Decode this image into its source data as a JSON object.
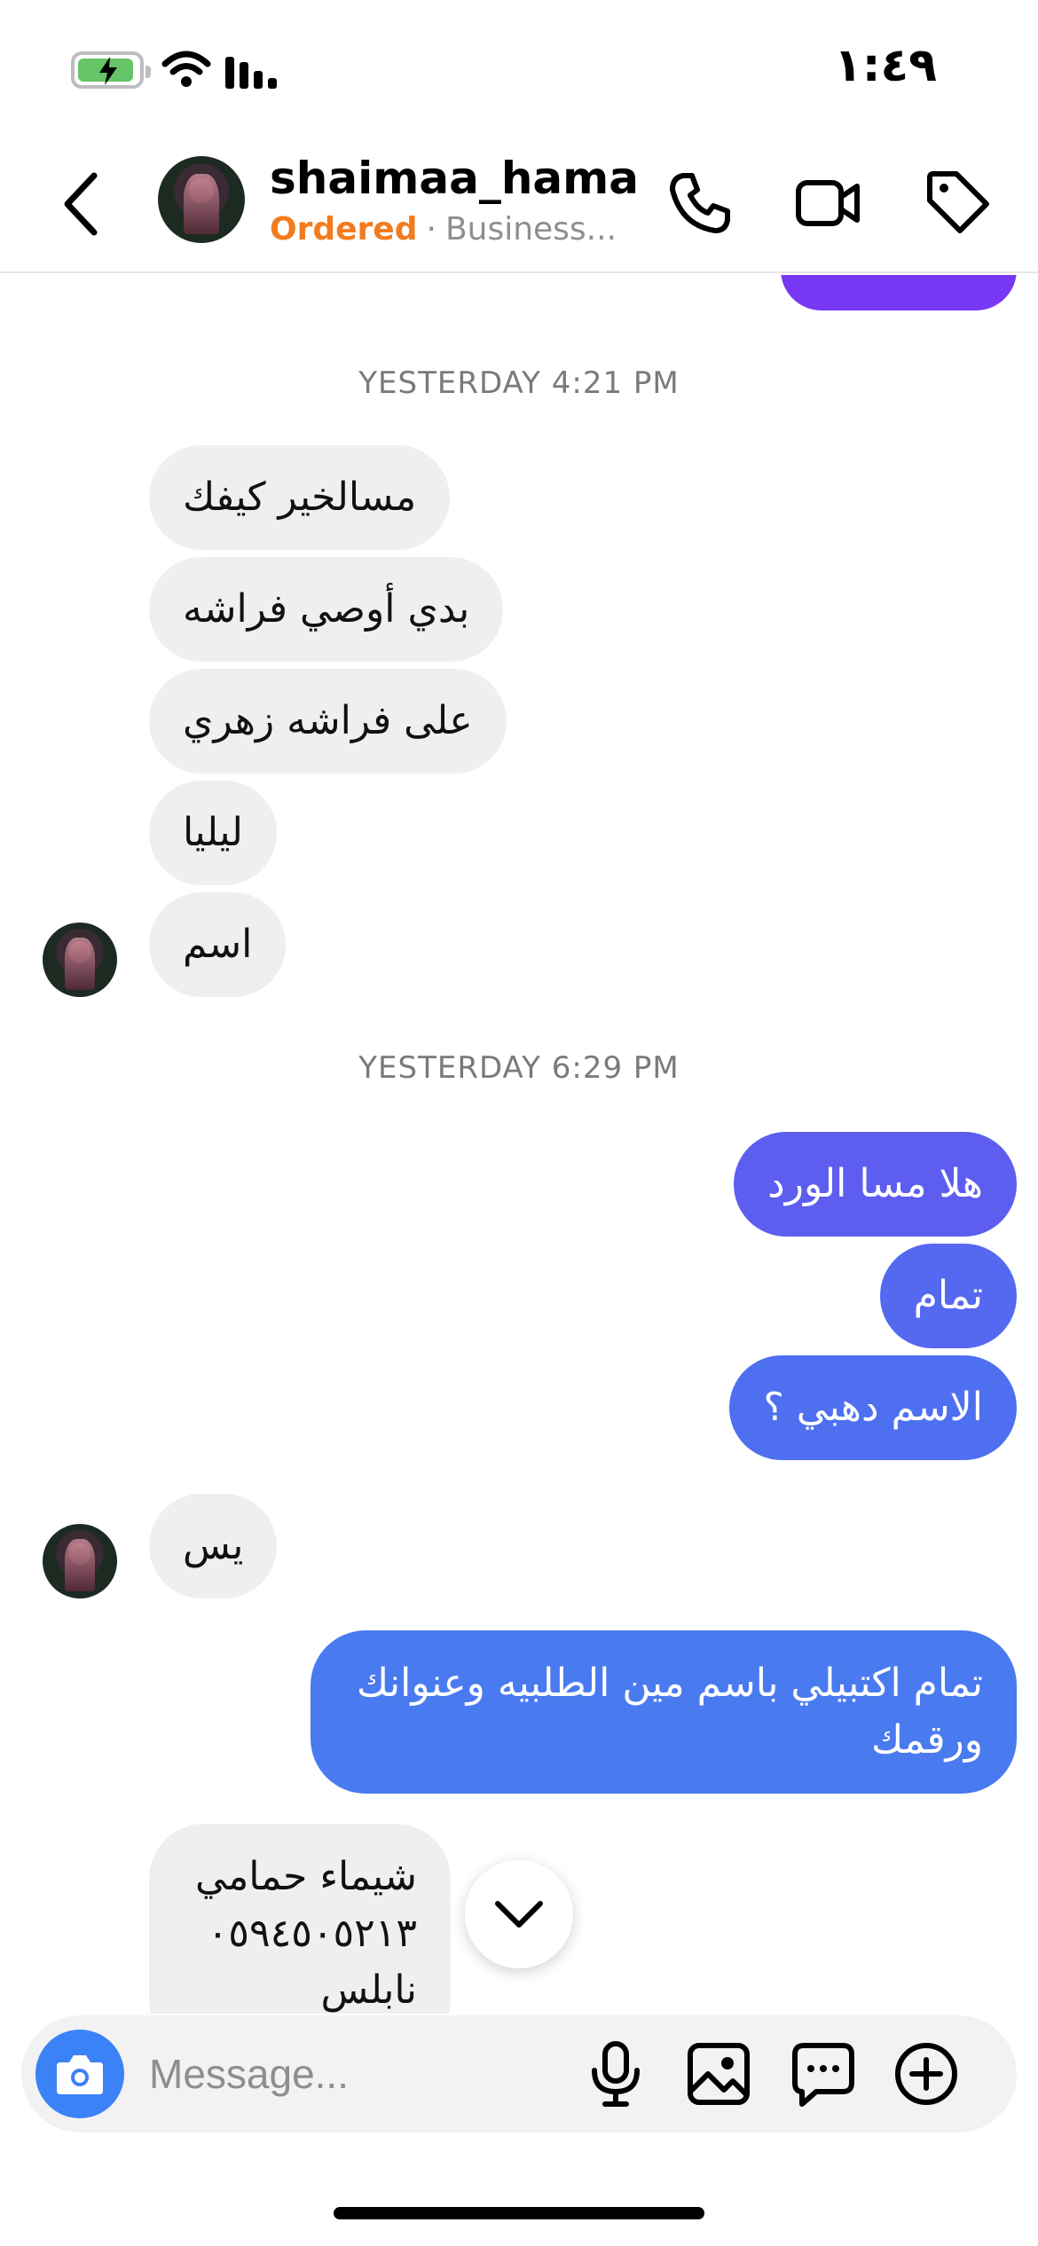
{
  "status_bar": {
    "time": "١:٤٩",
    "battery_color": "#65c466"
  },
  "header": {
    "contact_name": "shaimaa_hama...",
    "order_status": "Ordered",
    "separator": "·",
    "account_type": "Business...",
    "icons": [
      "back-chevron",
      "phone-icon",
      "video-camera-icon",
      "tag-icon"
    ]
  },
  "conversation": {
    "timestamps": [
      "YESTERDAY 4:21 PM",
      "YESTERDAY 6:29 PM"
    ],
    "messages": [
      {
        "sender": "contact",
        "text": "مسالخير كيفك"
      },
      {
        "sender": "contact",
        "text": "بدي أوصي فراشه"
      },
      {
        "sender": "contact",
        "text": "على فراشه زهري"
      },
      {
        "sender": "contact",
        "text": "ليليا"
      },
      {
        "sender": "contact",
        "text": "اسم"
      },
      {
        "sender": "me",
        "text": "هلا مسا الورد"
      },
      {
        "sender": "me",
        "text": "تمام"
      },
      {
        "sender": "me",
        "text": "الاسم دهبي ؟"
      },
      {
        "sender": "contact",
        "text": "يس"
      },
      {
        "sender": "me",
        "text": "تمام اكتبيلي باسم مين الطلبيه وعنوانك ورقمك"
      },
      {
        "sender": "contact",
        "text_lines": [
          "شيماء حمامي",
          "٠٥٩٤٥٠٥٢١٣",
          "نابلس"
        ]
      }
    ]
  },
  "composer": {
    "placeholder": "Message...",
    "icons": [
      "camera-icon",
      "microphone-icon",
      "gallery-icon",
      "sticker-icon",
      "plus-icon"
    ]
  },
  "colors": {
    "accent_purple": "#7737f3",
    "sent_bubble_1": "#5d5ef0",
    "sent_bubble_2": "#5568f0",
    "sent_bubble_3": "#4e6ff0",
    "sent_bubble_4": "#4a7af0",
    "received_bubble": "#efefef",
    "camera_button": "#3b82f6",
    "ordered_text": "#f37b1d"
  }
}
